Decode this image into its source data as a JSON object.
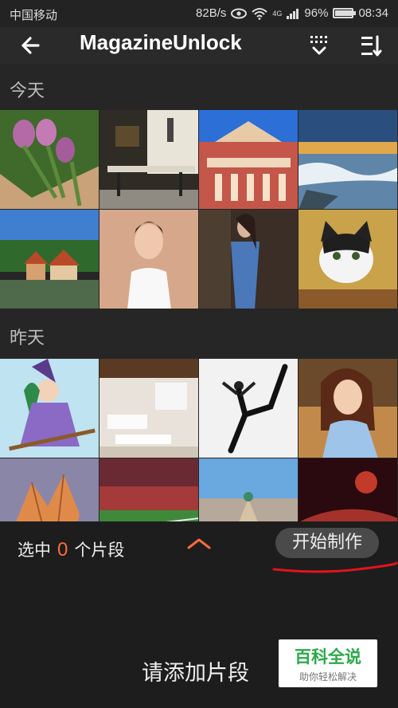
{
  "status_bar": {
    "carrier": "中国移动",
    "speed": "82B/s",
    "network": "4G",
    "battery_percent": "96%",
    "battery_level": 0.96,
    "time": "08:34"
  },
  "app_bar": {
    "title": "MagazineUnlock",
    "icons": [
      "back-arrow-icon",
      "select-all-icon",
      "sort-icon"
    ]
  },
  "sections": [
    {
      "label": "今天",
      "thumbnails": [
        "tulips",
        "dining-room",
        "opera-house",
        "waterfall-river",
        "riverside-houses",
        "woman-white-top",
        "woman-denim",
        "cat-kitten"
      ]
    },
    {
      "label": "昨天",
      "thumbnails": [
        "anime-witch",
        "living-room",
        "dancer",
        "woman-portrait",
        "autumn-leaves",
        "stadium",
        "barcelona-park",
        "red-planet"
      ]
    }
  ],
  "bottom_panel": {
    "selected_prefix": "选中",
    "selected_count": "0",
    "selected_suffix": "个片段",
    "start_button": "开始制作",
    "add_clip_hint": "请添加片段"
  },
  "watermark": {
    "title": "百科全说",
    "subtitle": "助你轻松解决"
  },
  "colors": {
    "accent": "#ff6a3d",
    "annotation": "#e0141c",
    "background": "#262626",
    "panel": "#1d1d1d"
  }
}
